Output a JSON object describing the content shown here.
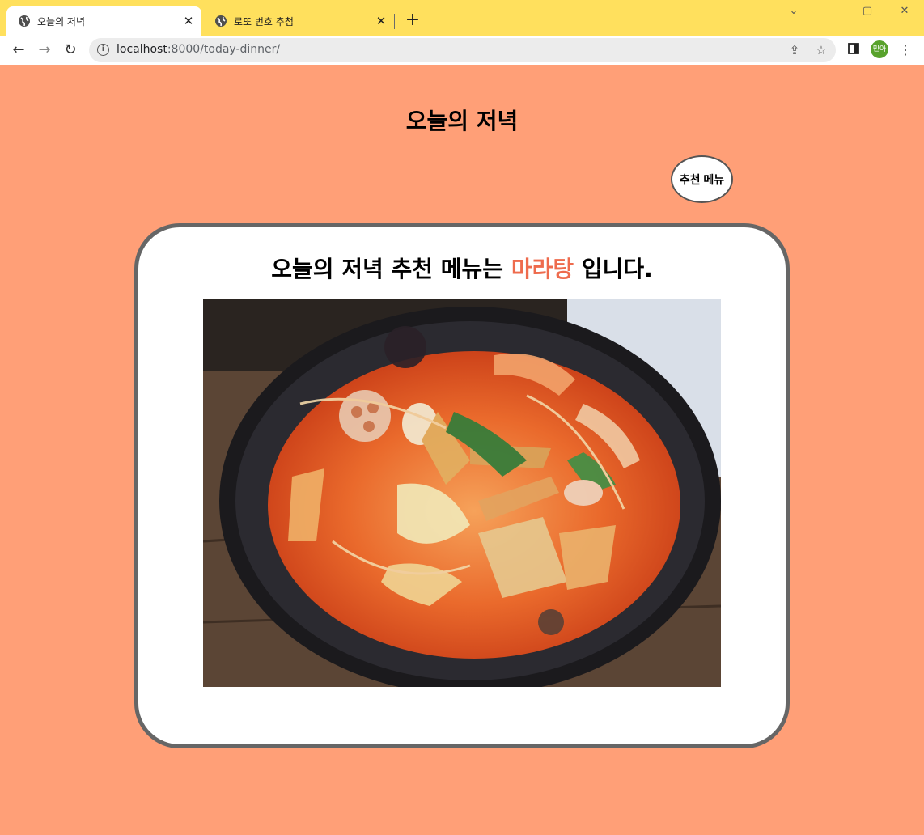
{
  "browser": {
    "tabs": [
      {
        "title": "오늘의 저녁",
        "active": true,
        "icon": "globe-icon"
      },
      {
        "title": "로또 번호 추첨",
        "active": false,
        "icon": "globe-icon"
      }
    ],
    "url_host": "localhost",
    "url_path": ":8000/today-dinner/",
    "profile_initials": "민아",
    "colors": {
      "titlebar": "#ffe05d",
      "profile": "#58a22c"
    }
  },
  "page": {
    "title": "오늘의 저녁",
    "recommend_button": "추천 메뉴",
    "heading_prefix": "오늘의 저녁 추천 메뉴는 ",
    "menu_name": "마라탕",
    "heading_suffix": " 입니다.",
    "image_subject": "mala-tang-bowl",
    "colors": {
      "background": "#ff9f77",
      "menu_name": "#ee6b4d",
      "card_border": "#666666"
    }
  }
}
